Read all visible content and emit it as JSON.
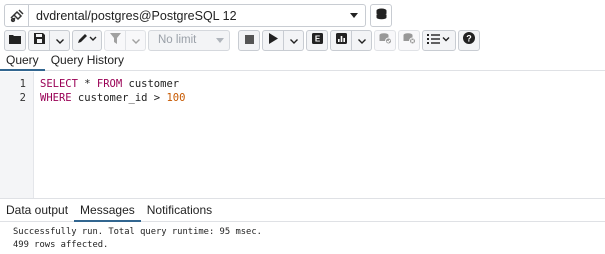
{
  "connection": {
    "label": "dvdrental/postgres@PostgreSQL 12",
    "icon": "plug-icon"
  },
  "toolbar": {
    "limit_label": "No limit",
    "icons": [
      "open-folder-icon",
      "save-icon",
      "edit-pen-icon",
      "filter-icon",
      "stop-icon",
      "execute-icon",
      "explain-icon",
      "explain-analyze-icon",
      "commit-icon",
      "rollback-icon",
      "macros-icon",
      "help-icon"
    ]
  },
  "query_tabs": [
    {
      "label": "Query",
      "active": true
    },
    {
      "label": "Query History",
      "active": false
    }
  ],
  "editor": {
    "lines": [
      {
        "number": "1",
        "kw1": "SELECT",
        "mid": " * ",
        "kw2": "FROM",
        "rest": " customer"
      },
      {
        "number": "2",
        "kw1": "WHERE",
        "mid": " customer_id > ",
        "num": "100"
      }
    ]
  },
  "result_tabs": [
    {
      "label": "Data output",
      "active": false
    },
    {
      "label": "Messages",
      "active": true
    },
    {
      "label": "Notifications",
      "active": false
    }
  ],
  "messages": [
    "Successfully run. Total query runtime: 95 msec.",
    "499 rows affected."
  ],
  "colors": {
    "active_tab_underline": "#326690",
    "keyword": "#990055",
    "number": "#c75900"
  }
}
